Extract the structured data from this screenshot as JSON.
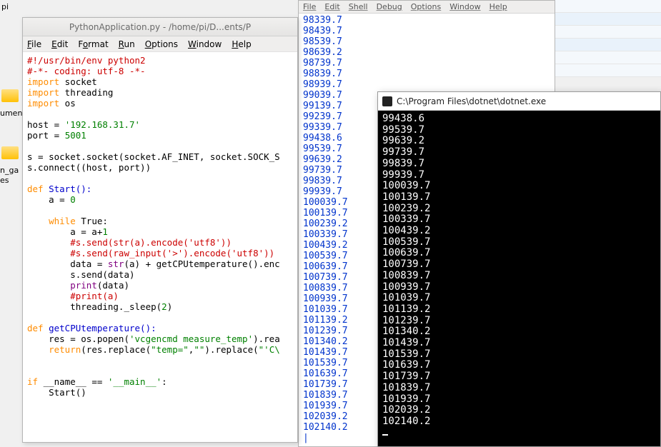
{
  "desktop": {
    "label_pi": "pi",
    "label_documents": "umen",
    "label_games": "n_ga",
    "label_es": "es"
  },
  "idle": {
    "title": "PythonApplication.py - /home/pi/D...ents/P",
    "menus": [
      "File",
      "Edit",
      "Format",
      "Run",
      "Options",
      "Window",
      "Help"
    ],
    "code": {
      "shebang": "#!/usr/bin/env python2",
      "coding": "#-*- coding: utf-8 -*-",
      "imp": "import",
      "sock": " socket",
      "thread": " threading",
      "os": " os",
      "host_var": "host = ",
      "host_val": "'192.168.31.7'",
      "port_var": "port = ",
      "port_val": "5001",
      "s_line": "s = socket.socket(socket.AF_INET, socket.SOCK_S",
      "connect": "s.connect((host, port))",
      "def": "def",
      "startname": " Start():",
      "a0": "    a = ",
      "zero": "0",
      "while": "while",
      "true": " True",
      "colon": ":",
      "a1": "        a = a+",
      "one": "1",
      "c1": "        #s.send(str(a).encode('utf8'))",
      "c2": "        #s.send(raw_input('>').encode('utf8'))",
      "data_line1": "        data = ",
      "str": "str",
      "data_line2": "(a) + getCPUtemperature().enc",
      "ssend": "        s.send(data)",
      "print": "print",
      "print_arg": "(data)",
      "cprint": "        #print(a)",
      "sleep": "        threading._sleep(",
      "sleep_val": "2",
      "sleep_end": ")",
      "getcpu": " getCPUtemperature():",
      "res": "    res = os.popen(",
      "res_str": "'vcgencmd measure_temp'",
      "res_end": ").rea",
      "return": "return",
      "ret_arg1": "(res.replace(",
      "ret_s1": "\"temp=\"",
      "ret_mid": ",",
      "ret_s2": "\"\"",
      "ret_arg2": ").replace(",
      "ret_s3": "\"'C\\",
      "if": "if",
      "name": " __name__ == ",
      "main": "'__main__'",
      "startcall": "    Start()"
    }
  },
  "shell": {
    "menus": [
      "File",
      "Edit",
      "Shell",
      "Debug",
      "Options",
      "Window",
      "Help"
    ],
    "lines": [
      "98339.7",
      "98439.7",
      "98539.7",
      "98639.2",
      "98739.7",
      "98839.7",
      "98939.7",
      "99039.7",
      "99139.7",
      "99239.7",
      "99339.7",
      "99438.6",
      "99539.7",
      "99639.2",
      "99739.7",
      "99839.7",
      "99939.7",
      "100039.7",
      "100139.7",
      "100239.2",
      "100339.7",
      "100439.2",
      "100539.7",
      "100639.7",
      "100739.7",
      "100839.7",
      "100939.7",
      "101039.7",
      "101139.2",
      "101239.7",
      "101340.2",
      "101439.7",
      "101539.7",
      "101639.7",
      "101739.7",
      "101839.7",
      "101939.7",
      "102039.2",
      "102140.2"
    ],
    "prompt": "|"
  },
  "dotnet": {
    "title": "C:\\Program Files\\dotnet\\dotnet.exe",
    "lines": [
      "99438.6",
      "99539.7",
      "99639.2",
      "99739.7",
      "99839.7",
      "99939.7",
      "100039.7",
      "100139.7",
      "100239.2",
      "100339.7",
      "100439.2",
      "100539.7",
      "100639.7",
      "100739.7",
      "100839.7",
      "100939.7",
      "101039.7",
      "101139.2",
      "101239.7",
      "101340.2",
      "101439.7",
      "101539.7",
      "101639.7",
      "101739.7",
      "101839.7",
      "101939.7",
      "102039.2",
      "102140.2"
    ]
  }
}
